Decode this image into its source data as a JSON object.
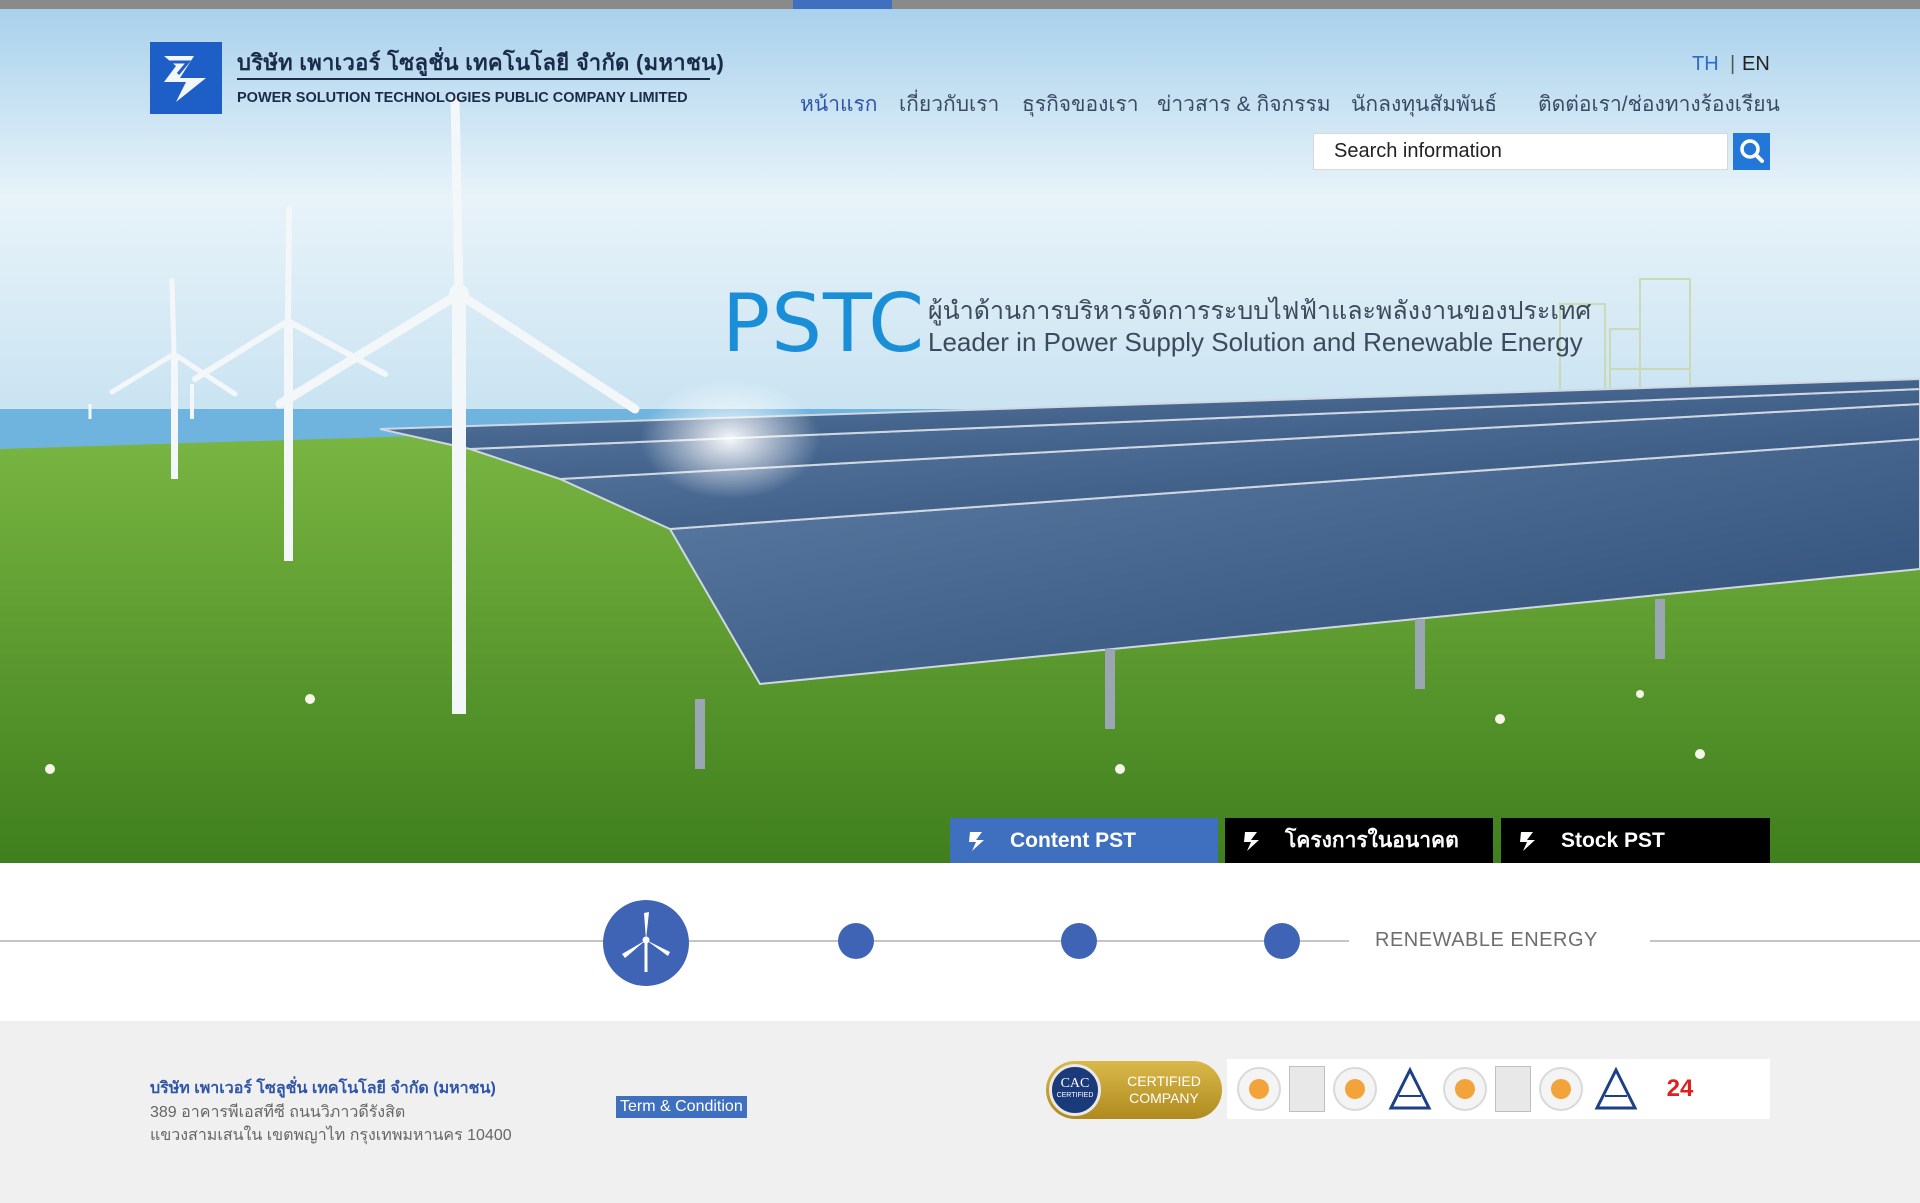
{
  "header": {
    "company_name_th": "บริษัท เพาเวอร์ โซลูชั่น เทคโนโลยี จำกัด (มหาชน)",
    "company_name_en": "POWER SOLUTION TECHNOLOGIES PUBLIC COMPANY LIMITED",
    "lang_th": "TH",
    "lang_sep": "|",
    "lang_en": "EN"
  },
  "nav": {
    "items": [
      {
        "label": "หน้าแรก",
        "active": true
      },
      {
        "label": "เกี่ยวกับเรา",
        "active": false
      },
      {
        "label": "ธุรกิจของเรา",
        "active": false
      },
      {
        "label": "ข่าวสาร & กิจกรรม",
        "active": false
      },
      {
        "label": "นักลงทุนสัมพันธ์",
        "active": false
      },
      {
        "label": "ติดต่อเรา/ช่องทางร้องเรียน",
        "active": false
      }
    ]
  },
  "search": {
    "placeholder": "Search information",
    "button_icon": "search-icon"
  },
  "hero": {
    "brand": "PSTC",
    "slogan_th": "ผู้นำด้านการบริหารจัดการระบบไฟฟ้าและพลังงานของประเทศ",
    "slogan_en": "Leader in Power Supply Solution and Renewable Energy"
  },
  "tabs": [
    {
      "label": "Content PST",
      "active": true
    },
    {
      "label": "โครงการในอนาคต",
      "active": false
    },
    {
      "label": "Stock PST",
      "active": false
    }
  ],
  "slider": {
    "caption": "RENEWABLE ENERGY",
    "main_icon": "wind-turbine-icon"
  },
  "footer": {
    "company_name": "บริษัท เพาเวอร์ โซลูชั่น เทคโนโลยี จำกัด (มหาชน)",
    "address_line1": "389  อาคารพีเอสทีซี ถนนวิภาวดีรังสิต",
    "address_line2": "แขวงสามเสนใน  เขตพญาไท  กรุงเทพมหานคร 10400",
    "term_link": "Term & Condition",
    "cac_logo_text": "CAC",
    "cac_logo_sub": "CERTIFIED",
    "cac_label_line1": "CERTIFIED",
    "cac_label_line2": "COMPANY",
    "cert_24_text": "24"
  },
  "colors": {
    "accent_blue": "#3f6fbf",
    "brand_blue": "#1a8fd8",
    "search_button": "#2377d8",
    "tab_inactive": "#000000"
  }
}
